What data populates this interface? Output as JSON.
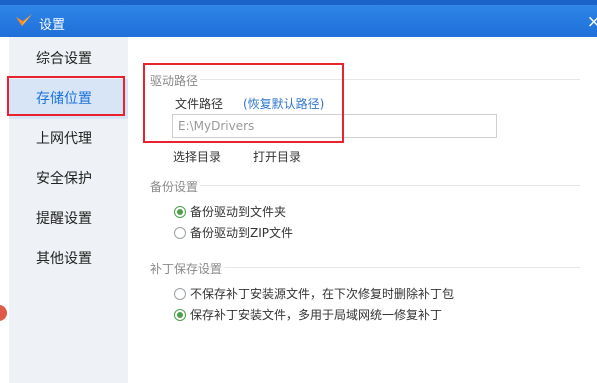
{
  "window": {
    "title": "设置",
    "close_glyph": "×",
    "logo_icon": "app-v-logo",
    "accent_color": "#2580e3"
  },
  "sidebar": {
    "items": [
      {
        "label": "综合设置",
        "active": false
      },
      {
        "label": "存储位置",
        "active": true
      },
      {
        "label": "上网代理",
        "active": false
      },
      {
        "label": "安全保护",
        "active": false
      },
      {
        "label": "提醒设置",
        "active": false
      },
      {
        "label": "其他设置",
        "active": false
      }
    ]
  },
  "driver_path": {
    "section_title": "驱动路径",
    "file_path_label": "文件路径",
    "restore_link": "(恢复默认路径)",
    "path_value": "E:\\MyDrivers",
    "select_dir": "选择目录",
    "open_dir": "打开目录"
  },
  "backup": {
    "section_title": "备份设置",
    "options": [
      {
        "label": "备份驱动到文件夹",
        "checked": true
      },
      {
        "label": "备份驱动到ZIP文件",
        "checked": false
      }
    ]
  },
  "patch": {
    "section_title": "补丁保存设置",
    "options": [
      {
        "label": "不保存补丁安装源文件，在下次修复时删除补丁包",
        "checked": false
      },
      {
        "label": "保存补丁安装文件，多用于局域网统一修复补丁",
        "checked": true
      }
    ]
  }
}
